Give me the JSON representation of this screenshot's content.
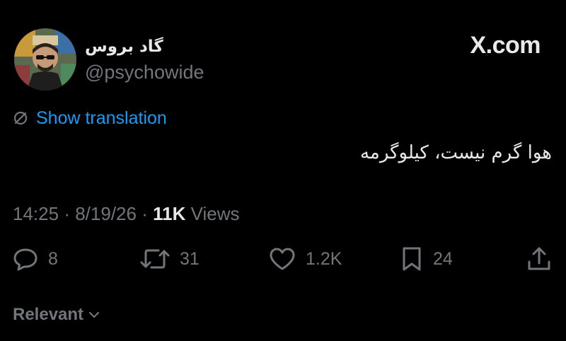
{
  "author": {
    "display_name": "گاد بروس",
    "handle": "@psychowide"
  },
  "brand": {
    "label": "X.com"
  },
  "translation": {
    "label": "Show translation"
  },
  "tweet": {
    "text": "هوا گرم نیست، کیلوگرمه"
  },
  "meta": {
    "time": "14:25",
    "separator": "·",
    "date": "8/19/26",
    "views_count": "11K",
    "views_label": "Views"
  },
  "actions": {
    "replies": {
      "icon": "reply-icon",
      "count": "8"
    },
    "reposts": {
      "icon": "repost-icon",
      "count": "31"
    },
    "likes": {
      "icon": "like-icon",
      "count": "1.2K"
    },
    "bookmarks": {
      "icon": "bookmark-icon",
      "count": "24"
    },
    "share": {
      "icon": "share-icon"
    }
  },
  "replies_sort": {
    "label": "Relevant",
    "icon": "chevron-down-icon"
  },
  "colors": {
    "background": "#000000",
    "primary_text": "#e7e9ea",
    "secondary_text": "#71767b",
    "accent": "#1d9bf0"
  }
}
